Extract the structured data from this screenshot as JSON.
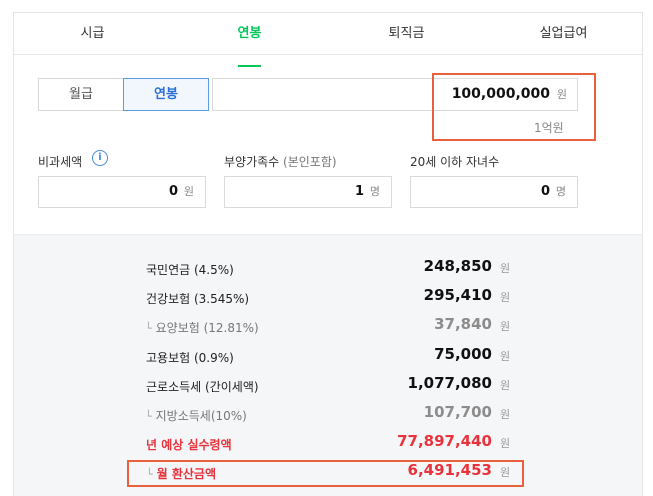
{
  "tabs": [
    {
      "label": "시급",
      "active": false
    },
    {
      "label": "연봉",
      "active": true
    },
    {
      "label": "퇴직금",
      "active": false
    },
    {
      "label": "실업급여",
      "active": false
    }
  ],
  "pay_type": {
    "monthly": "월급",
    "annual": "연봉",
    "selected": "연봉"
  },
  "amount": {
    "value": "100,000,000",
    "unit": "원",
    "hint": "1억원"
  },
  "fields": {
    "nontax": {
      "label": "비과세액",
      "info_icon": "i",
      "value": "0",
      "unit": "원"
    },
    "dependents": {
      "label": "부양가족수",
      "label_sub": "(본인포함)",
      "value": "1",
      "unit": "명"
    },
    "children": {
      "label": "20세 이하 자녀수",
      "value": "0",
      "unit": "명"
    }
  },
  "results": [
    {
      "label": "국민연금 (4.5%)",
      "value": "248,850",
      "unit": "원",
      "kind": "normal"
    },
    {
      "label": "건강보험 (3.545%)",
      "value": "295,410",
      "unit": "원",
      "kind": "normal"
    },
    {
      "label": "요양보험 (12.81%)",
      "value": "37,840",
      "unit": "원",
      "kind": "sub"
    },
    {
      "label": "고용보험 (0.9%)",
      "value": "75,000",
      "unit": "원",
      "kind": "normal"
    },
    {
      "label": "근로소득세 (간이세액)",
      "value": "1,077,080",
      "unit": "원",
      "kind": "normal"
    },
    {
      "label": "지방소득세(10%)",
      "value": "107,700",
      "unit": "원",
      "kind": "sub"
    },
    {
      "label": "년 예상 실수령액",
      "value": "77,897,440",
      "unit": "원",
      "kind": "highlight"
    },
    {
      "label": "월 환산금액",
      "value": "6,491,453",
      "unit": "원",
      "kind": "highlight-sub"
    }
  ],
  "colors": {
    "accent": "#03c75a",
    "highlight": "#e8323c",
    "annotation": "#e8603c",
    "selected_border": "#5a9ae8"
  },
  "icons": {
    "branch": "└",
    "info": "info-icon"
  }
}
